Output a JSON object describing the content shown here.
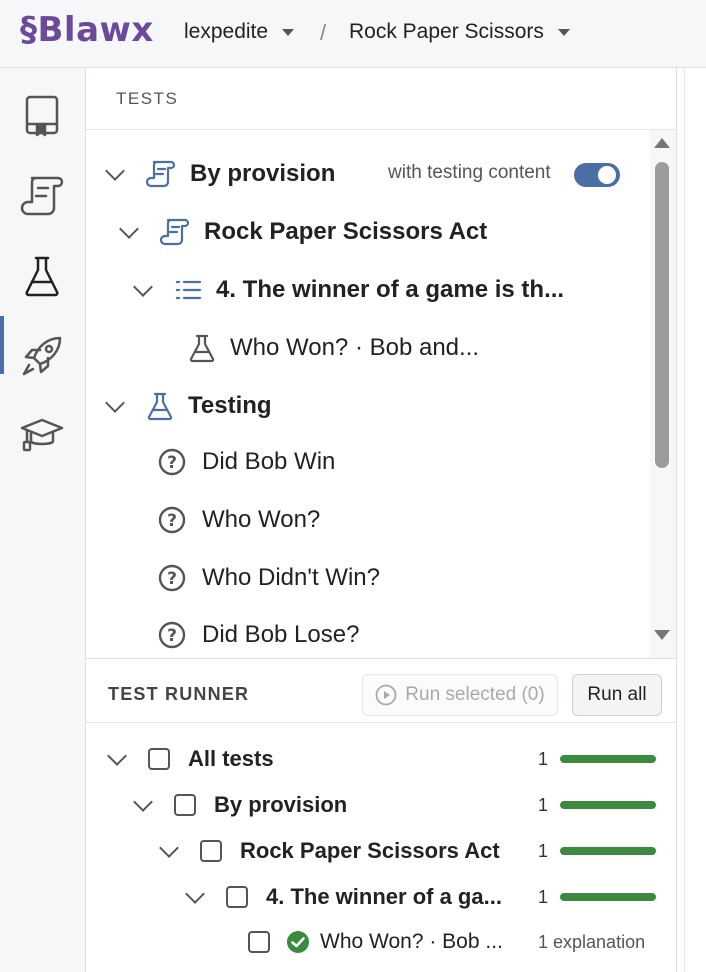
{
  "header": {
    "logo": "§Blawx",
    "org": "lexpedite",
    "separator": "/",
    "project": "Rock Paper Scissors"
  },
  "rail": {
    "items": [
      {
        "icon": "book-icon"
      },
      {
        "icon": "scroll-icon"
      },
      {
        "icon": "flask-icon",
        "active": true
      },
      {
        "icon": "rocket-icon"
      },
      {
        "icon": "graduation-cap-icon"
      }
    ]
  },
  "tests_panel": {
    "title": "TESTS",
    "toggle_label": "with testing content",
    "toggle_on": true,
    "tree": {
      "by_provision": "By provision",
      "act": "Rock Paper Scissors Act",
      "section": "4. The winner of a game is th...",
      "test": "Who Won? · Bob and...",
      "testing": "Testing",
      "questions": [
        "Did Bob Win",
        "Who Won?",
        "Who Didn't Win?",
        "Did Bob Lose?"
      ]
    }
  },
  "runner": {
    "title": "TEST RUNNER",
    "run_selected": "Run selected (0)",
    "run_all": "Run all",
    "rows": [
      {
        "label": "All tests",
        "count": "1"
      },
      {
        "label": "By provision",
        "count": "1"
      },
      {
        "label": "Rock Paper Scissors Act",
        "count": "1"
      },
      {
        "label": "4. The winner of a ga...",
        "count": "1"
      },
      {
        "label": "Who Won? · Bob ...",
        "explanation": "1 explanation"
      }
    ],
    "pass_color": "#3b8a3e"
  }
}
